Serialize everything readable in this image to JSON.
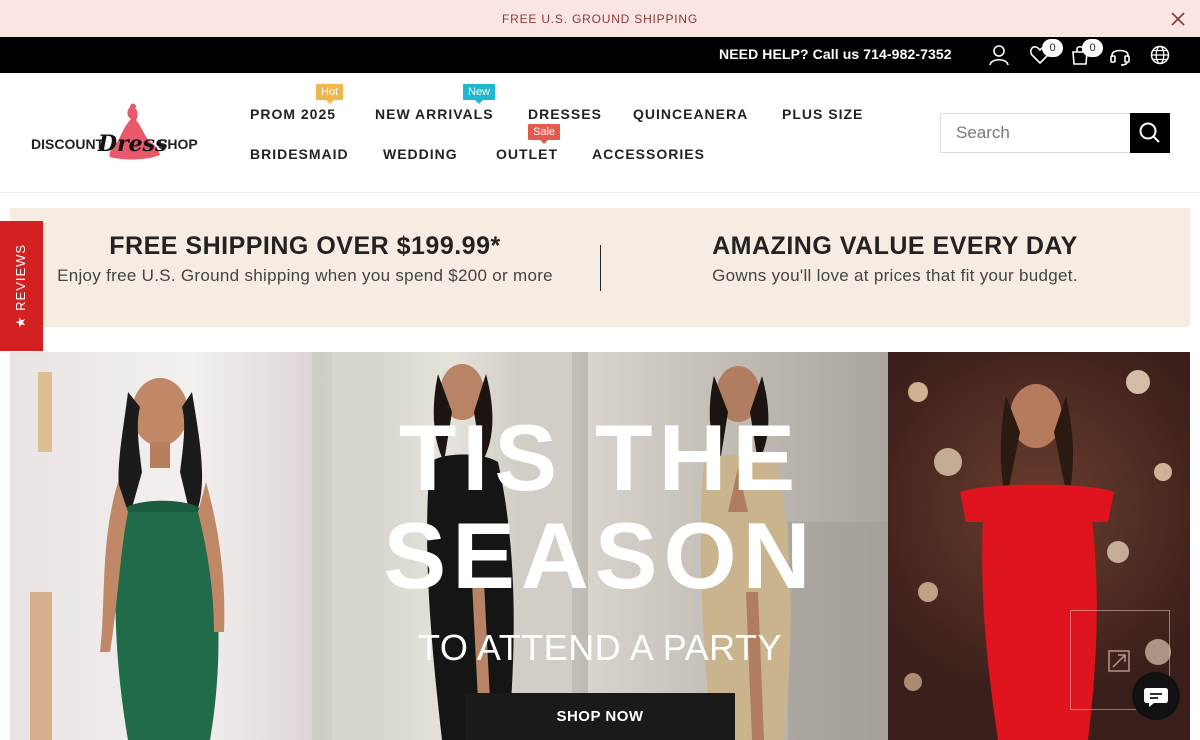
{
  "announcement": {
    "text": "FREE U.S. GROUND SHIPPING"
  },
  "topbar": {
    "help_text": "NEED HELP? Call us 714-982-7352",
    "wishlist_count": "0",
    "cart_count": "0",
    "icons": [
      "user-icon",
      "heart-icon",
      "bag-icon",
      "headset-icon",
      "globe-icon"
    ]
  },
  "logo": {
    "left_text": "DISCOUNT",
    "script_text": "Dress",
    "right_text": "SHOP",
    "accent_color": "#e85a6b"
  },
  "nav": {
    "row1": [
      {
        "label": "PROM 2025",
        "badge": "Hot"
      },
      {
        "label": "NEW ARRIVALS",
        "badge": "New"
      },
      {
        "label": "DRESSES"
      },
      {
        "label": "QUINCEANERA"
      },
      {
        "label": "PLUS SIZE"
      }
    ],
    "row2": [
      {
        "label": "BRIDESMAID"
      },
      {
        "label": "WEDDING"
      },
      {
        "label": "OUTLET",
        "badge": "Sale"
      },
      {
        "label": "ACCESSORIES"
      }
    ]
  },
  "search": {
    "placeholder": "Search"
  },
  "promo": {
    "left": {
      "title": "FREE SHIPPING OVER $199.99*",
      "subtitle": "Enjoy free U.S. Ground shipping when you spend $200 or more"
    },
    "right": {
      "title": "AMAZING VALUE EVERY DAY",
      "subtitle": "Gowns you'll love at prices that fit your budget."
    }
  },
  "reviews_tab": {
    "label": "★ REVIEWS"
  },
  "hero": {
    "title_line1": "TIS THE",
    "title_line2": "SEASON",
    "subtitle": "TO ATTEND A PARTY",
    "cta": "SHOP NOW",
    "dress_colors": [
      "#1f6b4a",
      "#151515",
      "#c9b48e",
      "#e0141e"
    ]
  },
  "colors": {
    "announcement_bg": "#fbe5e3",
    "promo_bg": "#f7ece1",
    "reviews_red": "#d32020",
    "badge_hot": "#f2b64f",
    "badge_new": "#20b7d0",
    "badge_sale": "#e35a4f"
  }
}
